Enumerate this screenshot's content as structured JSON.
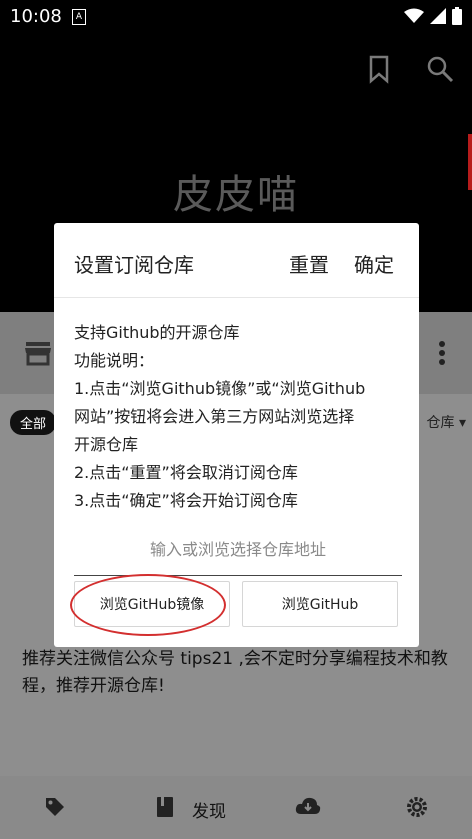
{
  "status_bar": {
    "time": "10:08",
    "notification_letter": "A"
  },
  "header": {
    "app_title": "皮皮喵",
    "icons": [
      "bookmark-icon",
      "search-icon"
    ]
  },
  "background": {
    "chip_all": "全部",
    "repo_tag": "仓库 ▾",
    "recommend_text": "推荐关注微信公众号 tips21 ,会不定时分享编程技术和教程，推荐开源仓库!"
  },
  "bottom_nav": {
    "items": [
      "tag-icon",
      "book-icon",
      "cloud-download-icon",
      "settings-icon"
    ],
    "discover_label": "发现"
  },
  "dialog": {
    "title": "设置订阅仓库",
    "reset_label": "重置",
    "confirm_label": "确定",
    "description": [
      "支持Github的开源仓库",
      "功能说明：",
      "1.点击“浏览Github镜像”或“浏览Github",
      "网站”按钮将会进入第三方网站浏览选择",
      "开源仓库",
      "2.点击“重置”将会取消订阅仓库",
      "3.点击“确定”将会开始订阅仓库"
    ],
    "input_placeholder": "输入或浏览选择仓库地址",
    "mirror_button": "浏览GitHub镜像",
    "github_button": "浏览GitHub"
  },
  "colors": {
    "highlight_ellipse": "#d32f2f",
    "scrim": "#8e8e8e"
  }
}
